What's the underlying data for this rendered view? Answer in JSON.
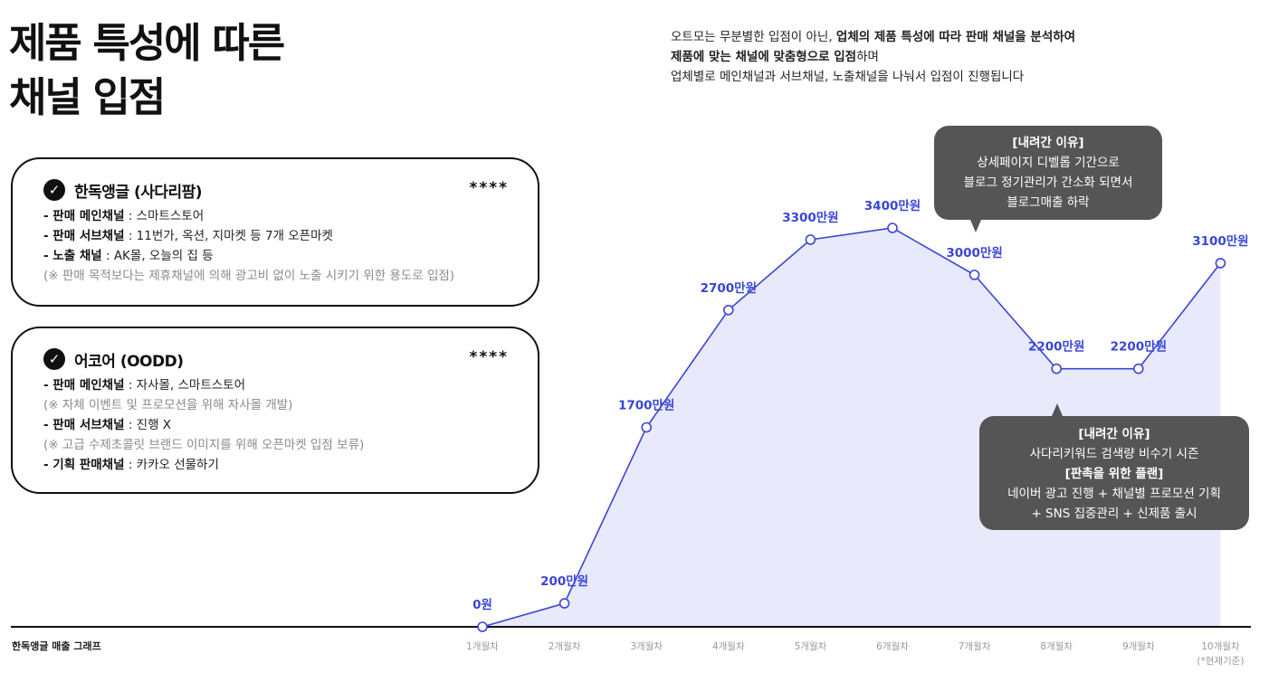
{
  "title": {
    "line1": "제품 특성에 따른",
    "line2": "채널 입점"
  },
  "description": {
    "line1_a": "오트모는 무분별한 입점이 아닌, ",
    "line1_b": "업체의 제품 특성에 따라 판매 채널을 분석하여",
    "line2_a": "제품에 맞는 채널에 맞춤형으로 입점",
    "line2_b": "하며",
    "line3": "업체별로 메인채널과 서브채널, 노출채널을 나눠서 입점이 진행됩니다"
  },
  "cards": [
    {
      "name": "한독앵글 (사다리팜)",
      "rating": "****",
      "lines": [
        {
          "label": "- 판매 메인채널",
          "text": " : 스마트스토어"
        },
        {
          "label": "- 판매 서브채널",
          "text": " : 11번가, 옥션, 지마켓 등 7개 오픈마켓"
        },
        {
          "label": "- 노출 채널",
          "text": " : AK몰, 오늘의 집 등"
        },
        {
          "note": "(※ 판매 목적보다는 제휴채널에 의해 광고비 없이 노출 시키기 위한 용도로 입점)"
        }
      ]
    },
    {
      "name": "어코어 (OODD)",
      "rating": "****",
      "lines": [
        {
          "label": "- 판매 메인채널",
          "text": " : 자사몰, 스마트스토어"
        },
        {
          "note": "(※ 자체 이벤트 및 프로모션을 위해 자사몰 개발)"
        },
        {
          "label": "- 판매 서브채널",
          "text": " : 진행 X"
        },
        {
          "note": "(※ 고급 수제초콜릿 브랜드 이미지를 위해 오픈마켓 입점 보류)"
        },
        {
          "label": "- 기획 판매채널",
          "text": " : 카카오 선물하기"
        }
      ]
    }
  ],
  "bubbles": {
    "down1": {
      "heading": "[내려간 이유]",
      "lines": [
        "상세페이지 디벨롭 기간으로",
        "블로그 정기관리가 간소화 되면서",
        "블로그매출 하락"
      ]
    },
    "down2": {
      "heading": "[내려간 이유]",
      "line1": "사다리키워드 검색량 비수기 시즌",
      "heading2": "[판촉을 위한 플랜]",
      "lines": [
        "네이버 광고 진행 + 채널별 프로모션 기획",
        "+ SNS 집중관리 + 신제품 출시"
      ]
    }
  },
  "chart_caption": "한독앵글 매출 그래프",
  "colors": {
    "line": "#3a46d6",
    "area": "#e8e9fa",
    "label": "#3a46d6",
    "tick": "#9a9a9a"
  },
  "chart_data": {
    "type": "area",
    "title": "한독앵글 매출 그래프",
    "categories": [
      "1개월차",
      "2개월차",
      "3개월차",
      "4개월차",
      "5개월차",
      "6개월차",
      "7개월차",
      "8개월차",
      "9개월차",
      "10개월차"
    ],
    "category_subtitle_last": "(*현재기준)",
    "values": [
      0,
      200,
      1700,
      2700,
      3300,
      3400,
      3000,
      2200,
      2200,
      3100
    ],
    "unit": "만원",
    "data_labels": [
      "0원",
      "200만원",
      "1700만원",
      "2700만원",
      "3300만원",
      "3400만원",
      "3000만원",
      "2200만원",
      "2200만원",
      "3100만원"
    ],
    "ylim": [
      0,
      3400
    ],
    "grid": false,
    "legend": "none"
  }
}
